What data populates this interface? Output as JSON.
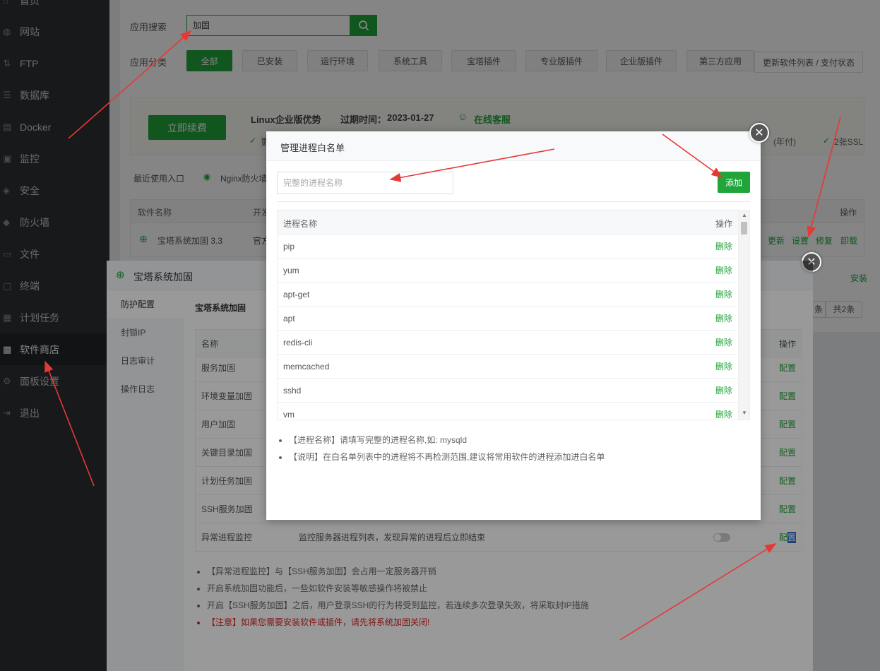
{
  "sidebar": {
    "items": [
      {
        "label": "首页",
        "icon": "home-icon"
      },
      {
        "label": "网站",
        "icon": "globe-icon"
      },
      {
        "label": "FTP",
        "icon": "ftp-icon"
      },
      {
        "label": "数据库",
        "icon": "database-icon"
      },
      {
        "label": "Docker",
        "icon": "docker-icon"
      },
      {
        "label": "监控",
        "icon": "monitor-icon"
      },
      {
        "label": "安全",
        "icon": "shield-icon"
      },
      {
        "label": "防火墙",
        "icon": "firewall-icon"
      },
      {
        "label": "文件",
        "icon": "folder-icon"
      },
      {
        "label": "终端",
        "icon": "terminal-icon"
      },
      {
        "label": "计划任务",
        "icon": "calendar-icon"
      },
      {
        "label": "软件商店",
        "icon": "grid-icon"
      },
      {
        "label": "面板设置",
        "icon": "gear-icon"
      },
      {
        "label": "退出",
        "icon": "logout-icon"
      }
    ]
  },
  "store": {
    "search_label": "应用搜索",
    "search_value": "加固",
    "category_label": "应用分类",
    "categories": [
      "全部",
      "已安装",
      "运行环境",
      "系统工具",
      "宝塔插件",
      "专业版插件",
      "企业版插件",
      "第三方应用"
    ],
    "update_button": "更新软件列表 / 支付状态",
    "banner": {
      "renew_button": "立即续费",
      "title": "Linux企业版优势",
      "expire_label": "过期时间：",
      "expire_date": "2023-01-27",
      "online_service": "在线客服",
      "partial_left": "更",
      "partial_mid": "(年付)",
      "partial_right": "2张SSL"
    },
    "recent_label": "最近使用入口",
    "recent_item": "Nginx防火墙",
    "table": {
      "col_name": "软件名称",
      "col_dev": "开发",
      "col_ops": "操作",
      "row_name": "宝塔系统加固 3.3",
      "row_dev": "官方",
      "row_ops": [
        "更新",
        "设置",
        "修复",
        "卸载"
      ],
      "row2_op": "安装",
      "total": "共2条",
      "pager_fragment": "条"
    }
  },
  "hardening": {
    "title": "宝塔系统加固",
    "tabs": [
      "防护配置",
      "封锁IP",
      "日志审计",
      "操作日志"
    ],
    "section_title": "宝塔系统加固",
    "col_name": "名称",
    "col_ops": "操作",
    "rows": [
      {
        "name": "服务加固",
        "op": "配置"
      },
      {
        "name": "环境变量加固",
        "op": "配置"
      },
      {
        "name": "用户加固",
        "op": "配置"
      },
      {
        "name": "关键目录加固",
        "op": "配置"
      },
      {
        "name": "计划任务加固",
        "op": "配置"
      },
      {
        "name": "SSH服务加固",
        "op": "配置"
      }
    ],
    "last_row": {
      "name": "异常进程监控",
      "desc": "监控服务器进程列表，发现异常的进程后立即结束",
      "op_a": "配",
      "op_b": "置"
    },
    "notes": [
      "【异常进程监控】与【SSH服务加固】会占用一定服务器开销",
      "开启系统加固功能后，一些如软件安装等敏感操作将被禁止",
      "开启【SSH服务加固】之后，用户登录SSH的行为将受到监控，若连续多次登录失败，将采取封IP措施"
    ],
    "warning": "【注意】如果您需要安装软件或插件，请先将系统加固关闭!"
  },
  "whitelist": {
    "title": "管理进程白名单",
    "input_placeholder": "完整的进程名称",
    "add_button": "添加",
    "col_name": "进程名称",
    "col_ops": "操作",
    "delete_label": "删除",
    "processes": [
      "pip",
      "yum",
      "apt-get",
      "apt",
      "redis-cli",
      "memcached",
      "sshd",
      "vm"
    ],
    "notes": [
      "【进程名称】请填写完整的进程名称,如: mysqld",
      "【说明】在白名单列表中的进程将不再检测范围,建议将常用软件的进程添加进白名单"
    ]
  },
  "colors": {
    "accent": "#20a53a",
    "sidebar": "#2c3034",
    "arrow": "#e53935",
    "warning": "#e02020"
  }
}
